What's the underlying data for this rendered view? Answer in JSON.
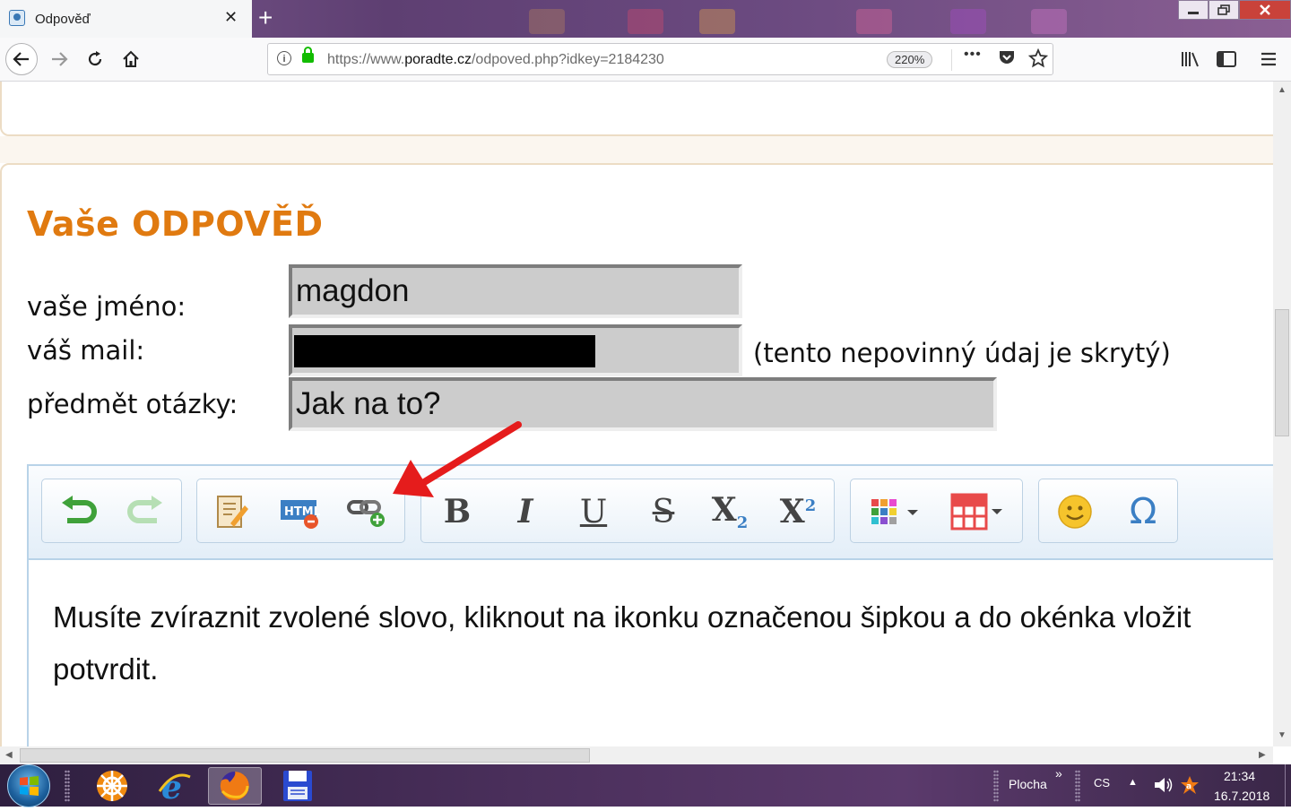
{
  "browser": {
    "tab_title": "Odpověď",
    "tab_close": "✕",
    "new_tab": "+",
    "url_scheme": "https://www.",
    "url_domain": "poradte.cz",
    "url_path": "/odpoved.php?idkey=2184230",
    "zoom": "220%",
    "page_actions": "•••"
  },
  "form": {
    "heading": "Vaše ODPOVĚĎ",
    "name_label": "vaše jméno:",
    "name_value": "magdon",
    "email_label": "váš mail:",
    "email_note": "(tento nepovinný údaj je skrytý)",
    "subject_label": "předmět otázky:",
    "subject_value": "Jak na to?"
  },
  "editor": {
    "toolbar": {
      "bold": "B",
      "italic": "I",
      "underline": "U",
      "strike": "S",
      "subscript": "X",
      "subscript_mark": "2",
      "superscript": "X",
      "superscript_mark": "2",
      "special_char": "Ω"
    },
    "content_line1": "Musíte zvíraznit zvolené slovo, kliknout na ikonku označenou šipkou a do okénka vložit",
    "content_line2": "potvrdit."
  },
  "taskbar": {
    "desktop_label": "Plocha",
    "language": "CS",
    "time": "21:34",
    "date": "16.7.2018"
  },
  "colors": {
    "heading": "#e07a10",
    "arrow": "#e51c1c",
    "lock": "#12bc00"
  }
}
